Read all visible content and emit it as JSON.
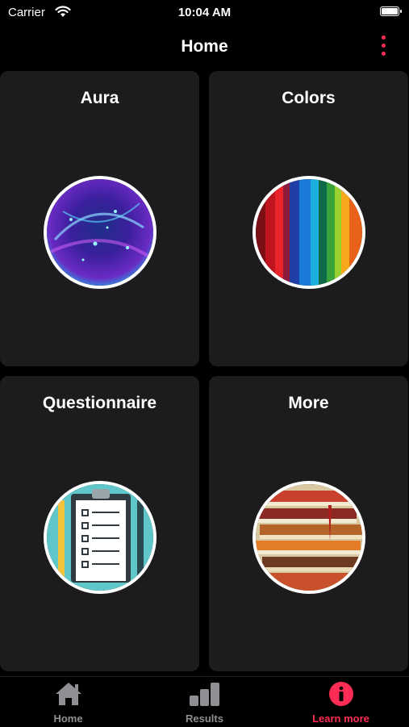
{
  "status_bar": {
    "carrier": "Carrier",
    "time": "10:04 AM"
  },
  "nav": {
    "title": "Home"
  },
  "tiles": [
    {
      "title": "Aura"
    },
    {
      "title": "Colors"
    },
    {
      "title": "Questionnaire"
    },
    {
      "title": "More"
    }
  ],
  "tabs": [
    {
      "label": "Home",
      "icon": "home-icon"
    },
    {
      "label": "Results",
      "icon": "bar-chart-icon"
    },
    {
      "label": "Learn more",
      "icon": "info-icon",
      "active": true
    }
  ],
  "colors": {
    "accent": "#ff2d55",
    "tile": "#1c1c1e",
    "inactive_tab": "#8e8e93"
  }
}
